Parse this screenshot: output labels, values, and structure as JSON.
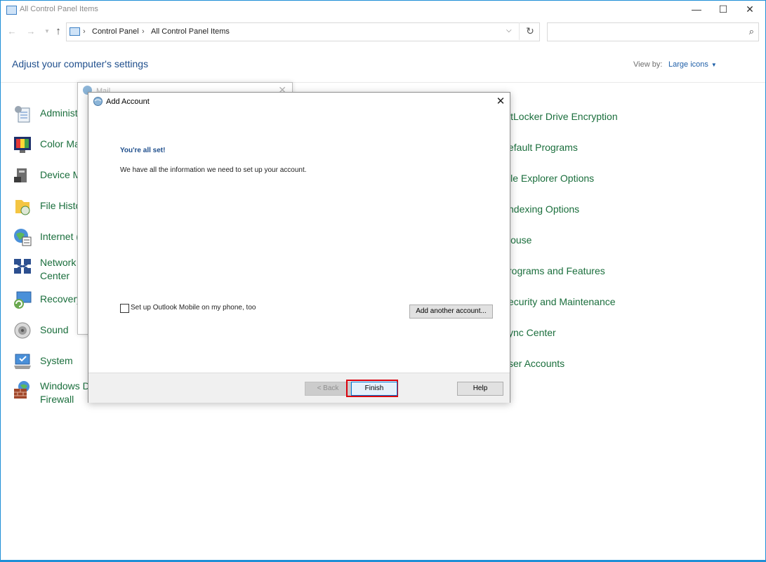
{
  "window": {
    "title": "All Control Panel Items",
    "minimize_glyph": "—",
    "maximize_glyph": "☐",
    "close_glyph": "✕"
  },
  "nav": {
    "breadcrumb": [
      "Control Panel",
      "All Control Panel Items"
    ],
    "separator": "›",
    "search_placeholder": ""
  },
  "header": {
    "heading": "Adjust your computer's settings",
    "view_by_label": "View by:",
    "view_mode": "Large icons"
  },
  "items_left": [
    {
      "label": "Administ",
      "icon": "administrative-tools-icon"
    },
    {
      "label": "Color Ma",
      "icon": "color-management-icon"
    },
    {
      "label": "Device M",
      "icon": "device-manager-icon"
    },
    {
      "label": "File Histo",
      "icon": "file-history-icon"
    },
    {
      "label": "Internet (",
      "icon": "internet-options-icon"
    },
    {
      "label": "Network\nCenter",
      "icon": "network-center-icon"
    },
    {
      "label": "Recovery",
      "icon": "recovery-icon"
    },
    {
      "label": "Sound",
      "icon": "sound-icon"
    },
    {
      "label": "System",
      "icon": "system-icon"
    },
    {
      "label": "Windows D\nFirewall",
      "icon": "firewall-icon"
    }
  ],
  "items_right": [
    {
      "label": "itLocker Drive Encryption"
    },
    {
      "label": "efault Programs"
    },
    {
      "label": "ile Explorer Options"
    },
    {
      "label": "ndexing Options"
    },
    {
      "label": "louse"
    },
    {
      "label": "rograms and Features"
    },
    {
      "label": "ecurity and Maintenance"
    },
    {
      "label": "ync Center"
    },
    {
      "label": "ser Accounts"
    }
  ],
  "mail_dialog": {
    "title": "Mail"
  },
  "add_account_dialog": {
    "title": "Add Account",
    "heading": "You're all set!",
    "message": "We have all the information we need to set up your account.",
    "checkbox_label": "Set up Outlook Mobile on my phone, too",
    "checkbox_checked": false,
    "add_another_button": "Add another account...",
    "back_button": "< Back",
    "finish_button": "Finish",
    "help_button": "Help"
  },
  "colors": {
    "accent": "#1e8fd6",
    "link_green": "#1a6e3c",
    "heading_blue": "#1e4e8c",
    "highlight_red": "#d9000d"
  }
}
